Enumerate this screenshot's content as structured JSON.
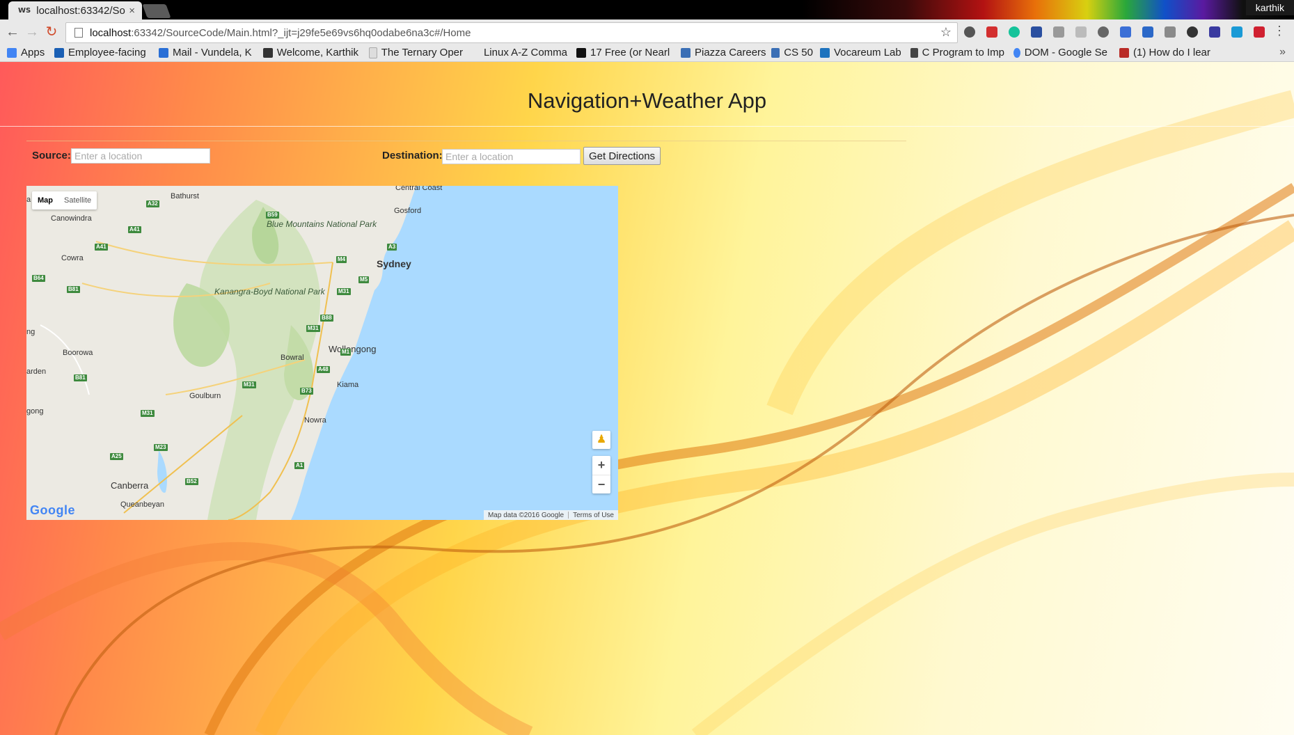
{
  "browser": {
    "tab_title": "localhost:63342/So",
    "tab_favicon": "WS",
    "tab_close": "×",
    "profile_name": "karthik",
    "url_host": "localhost",
    "url_rest": ":63342/SourceCode/Main.html?_ijt=j29fe5e69vs6hq0odabe6na3c#/Home",
    "back_icon": "←",
    "forward_icon": "→",
    "reload_icon": "↻",
    "star_icon": "☆",
    "menu_icon": "⋮"
  },
  "bookmarks": {
    "items": [
      {
        "label": "Apps",
        "icon_color": "#4285f4"
      },
      {
        "label": "Employee-facing",
        "icon_color": "#1a5fb4"
      },
      {
        "label": "Mail - Vundela, K",
        "icon_color": "#2a6fd6"
      },
      {
        "label": "Welcome, Karthik",
        "icon_color": "#333333"
      },
      {
        "label": "The Ternary Oper",
        "icon_color": "#dddddd"
      },
      {
        "label": "Linux A-Z Comma",
        "icon_color": "#e9e9e9"
      },
      {
        "label": "17 Free (or Nearl",
        "icon_color": "#111111"
      },
      {
        "label": "Piazza Careers",
        "icon_color": "#3b6fb5"
      },
      {
        "label": "CS 50",
        "icon_color": "#3b6fb5"
      },
      {
        "label": "Vocareum Lab",
        "icon_color": "#1e73be"
      },
      {
        "label": "C Program to Imp",
        "icon_color": "#444444"
      },
      {
        "label": "DOM - Google Se",
        "icon_color": "#4285f4"
      },
      {
        "label": "(1) How do I lear",
        "icon_color": "#b92b27"
      }
    ],
    "more": "»"
  },
  "app": {
    "title": "Navigation+Weather App",
    "source_label": "Source:",
    "source_placeholder": "Enter a location",
    "source_value": "",
    "destination_label": "Destination:",
    "destination_placeholder": "Enter a location",
    "destination_value": "",
    "get_directions_label": "Get Directions"
  },
  "map": {
    "type_map": "Map",
    "type_satellite": "Satellite",
    "active_type": "Map",
    "pegman_icon": "♟",
    "zoom_in": "+",
    "zoom_out": "−",
    "logo": "Google",
    "attribution": "Map data ©2016 Google",
    "terms": "Terms of Use",
    "cities": {
      "central_coast": "Central Coast",
      "bathurst": "Bathurst",
      "gosford": "Gosford",
      "canowindra": "Canowindra",
      "blue_mountains": "Blue Mountains National Park",
      "sydney": "Sydney",
      "cowra": "Cowra",
      "kanangra": "Kanangra-Boyd National Park",
      "wollongong": "Wollongong",
      "boorowa": "Boorowa",
      "bowral": "Bowral",
      "kiama": "Kiama",
      "goulburn": "Goulburn",
      "nowra": "Nowra",
      "canberra": "Canberra",
      "queanbeyan": "Queanbeyan",
      "ng": "ng",
      "arden": "arden",
      "gong": "gong",
      "ra_left": "a"
    },
    "roads": {
      "a32": "A32",
      "a41a": "A41",
      "a41b": "A41",
      "b59": "B59",
      "a3": "A3",
      "m4": "M4",
      "m5": "M5",
      "m31a": "M31",
      "b64": "B64",
      "b81a": "B81",
      "b88": "B88",
      "m31b": "M31",
      "m1": "M1",
      "a48": "A48",
      "b81b": "B81",
      "m31c": "M31",
      "b73": "B73",
      "m31d": "M31",
      "m23": "M23",
      "a25": "A25",
      "a1": "A1",
      "b52": "B52"
    }
  }
}
